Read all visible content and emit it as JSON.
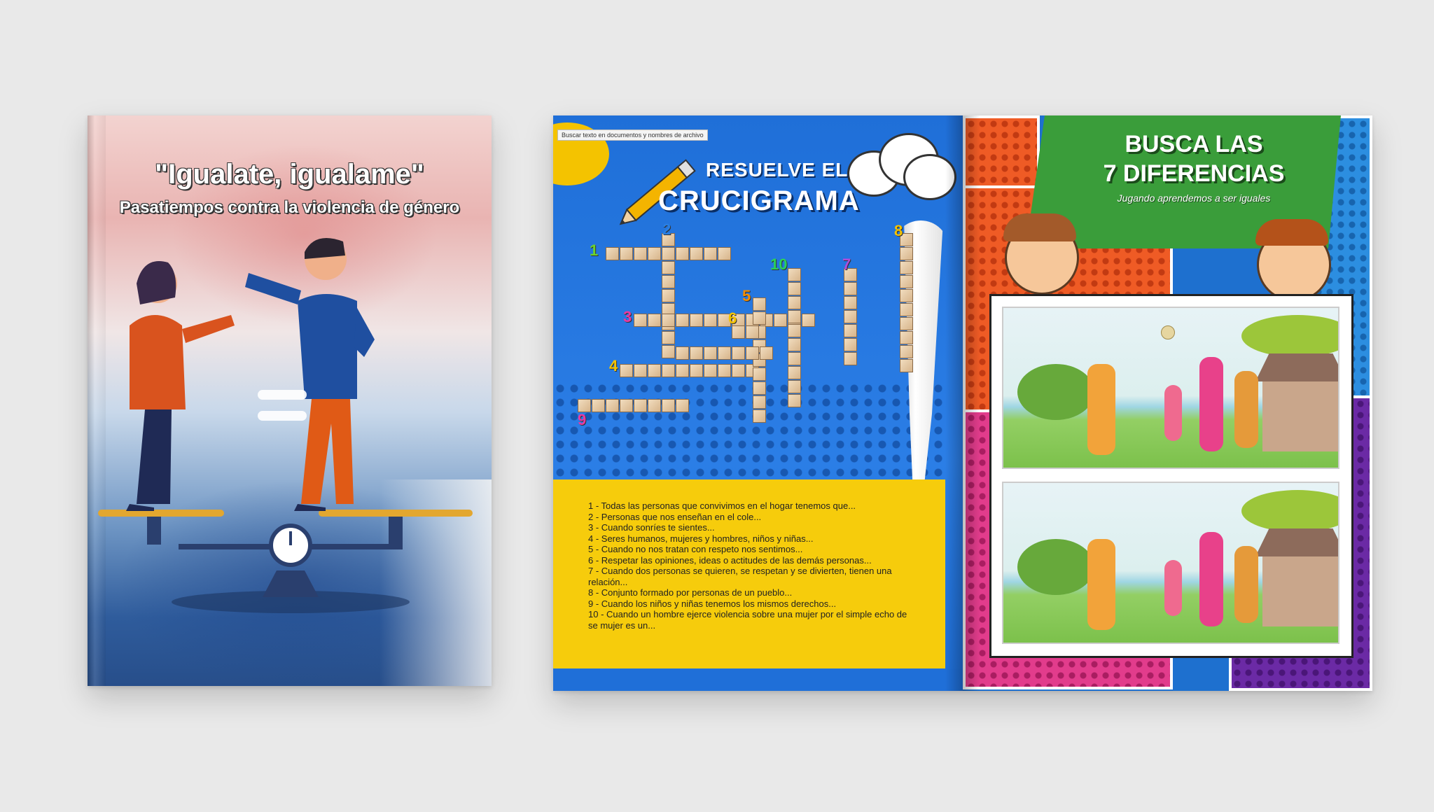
{
  "cover": {
    "title": "\"Igualate, igualame\"",
    "subtitle": "Pasatiempos contra la violencia de género"
  },
  "crossword_page": {
    "toolbar_text": "Buscar texto en documentos y nombres de archivo",
    "title_line1": "RESUELVE EL",
    "title_line2": "CRUCIGRAMA",
    "numbers": [
      "1",
      "2",
      "3",
      "4",
      "5",
      "6",
      "7",
      "8",
      "9",
      "10"
    ],
    "clues": [
      "1 - Todas las personas que convivimos en el hogar tenemos que...",
      "2 - Personas que nos enseñan en el cole...",
      "3 - Cuando sonríes te sientes...",
      "4 - Seres humanos, mujeres y hombres, niños y niñas...",
      "5 - Cuando no nos tratan con respeto nos sentimos...",
      "6 - Respetar las opiniones, ideas o actitudes de las demás personas...",
      "7 - Cuando dos personas se quieren, se respetan y se divierten, tienen una",
      "relación...",
      "8 - Conjunto formado por personas de un pueblo...",
      "9 - Cuando los niños y niñas tenemos los mismos derechos...",
      "10 - Cuando un hombre ejerce violencia sobre una mujer por el simple echo de",
      "se mujer es un..."
    ]
  },
  "differences_page": {
    "title_line1": "BUSCA LAS",
    "title_line2": "7 DIFERENCIAS",
    "subtitle": "Jugando aprendemos a ser iguales"
  },
  "colors": {
    "cover_pink": "#e9b4b2",
    "cover_blue": "#274e8a",
    "page_blue": "#1f6fd8",
    "clue_yellow": "#f6cc0c",
    "comic_green": "#3a9d3a"
  }
}
